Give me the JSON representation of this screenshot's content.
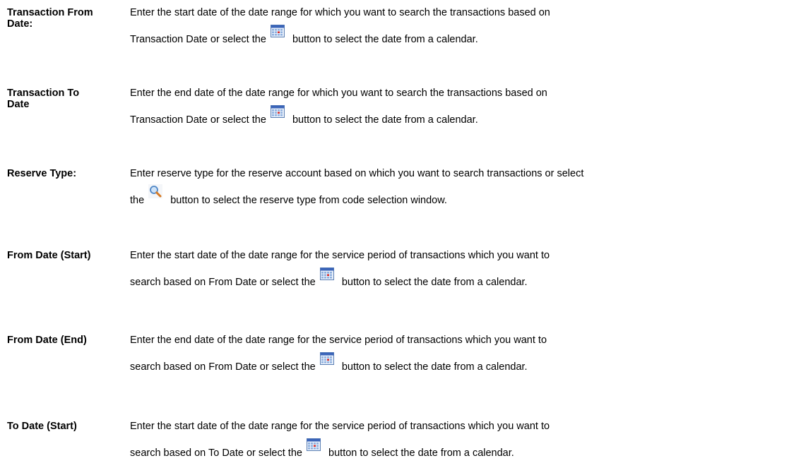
{
  "entries": [
    {
      "term": "Transaction From Date:",
      "line1": "Enter the start date of the date range for which you want to search the transactions based on",
      "line2_before": "Transaction Date or select the",
      "icon": "calendar-icon",
      "line2_after": "button to select the date from a calendar."
    },
    {
      "term": "Transaction To Date",
      "line1": "Enter the end date of the date range for which you want to search the transactions based on",
      "line2_before": "Transaction Date or select the",
      "icon": "calendar-icon",
      "line2_after": "button to select the date from a calendar."
    },
    {
      "term": "Reserve Type:",
      "line1": "Enter reserve type for the reserve account based on which you want to search transactions or select",
      "line2_before": "the",
      "icon": "search-icon",
      "line2_after": "button to select the reserve type from code selection window."
    },
    {
      "term": "From Date (Start)",
      "line1": "Enter the start date of the date range for the service period of transactions which you want to",
      "line2_before": "search  based on From Date or select the",
      "icon": "calendar-icon",
      "line2_after": "button to select the date from a calendar."
    },
    {
      "term": "From Date (End)",
      "line1": "Enter the end date of the date range for the service period of transactions which you want to",
      "line2_before": "search  based on From Date or select the",
      "icon": "calendar-icon",
      "line2_after": "button to select the date from a calendar."
    },
    {
      "term": "To Date (Start)",
      "line1": "Enter the start date of the date range for the service period of transactions which you want to",
      "line2_before": "search  based on To Date or select the",
      "icon": "calendar-icon",
      "line2_after": "button to select the date from a calendar."
    }
  ]
}
